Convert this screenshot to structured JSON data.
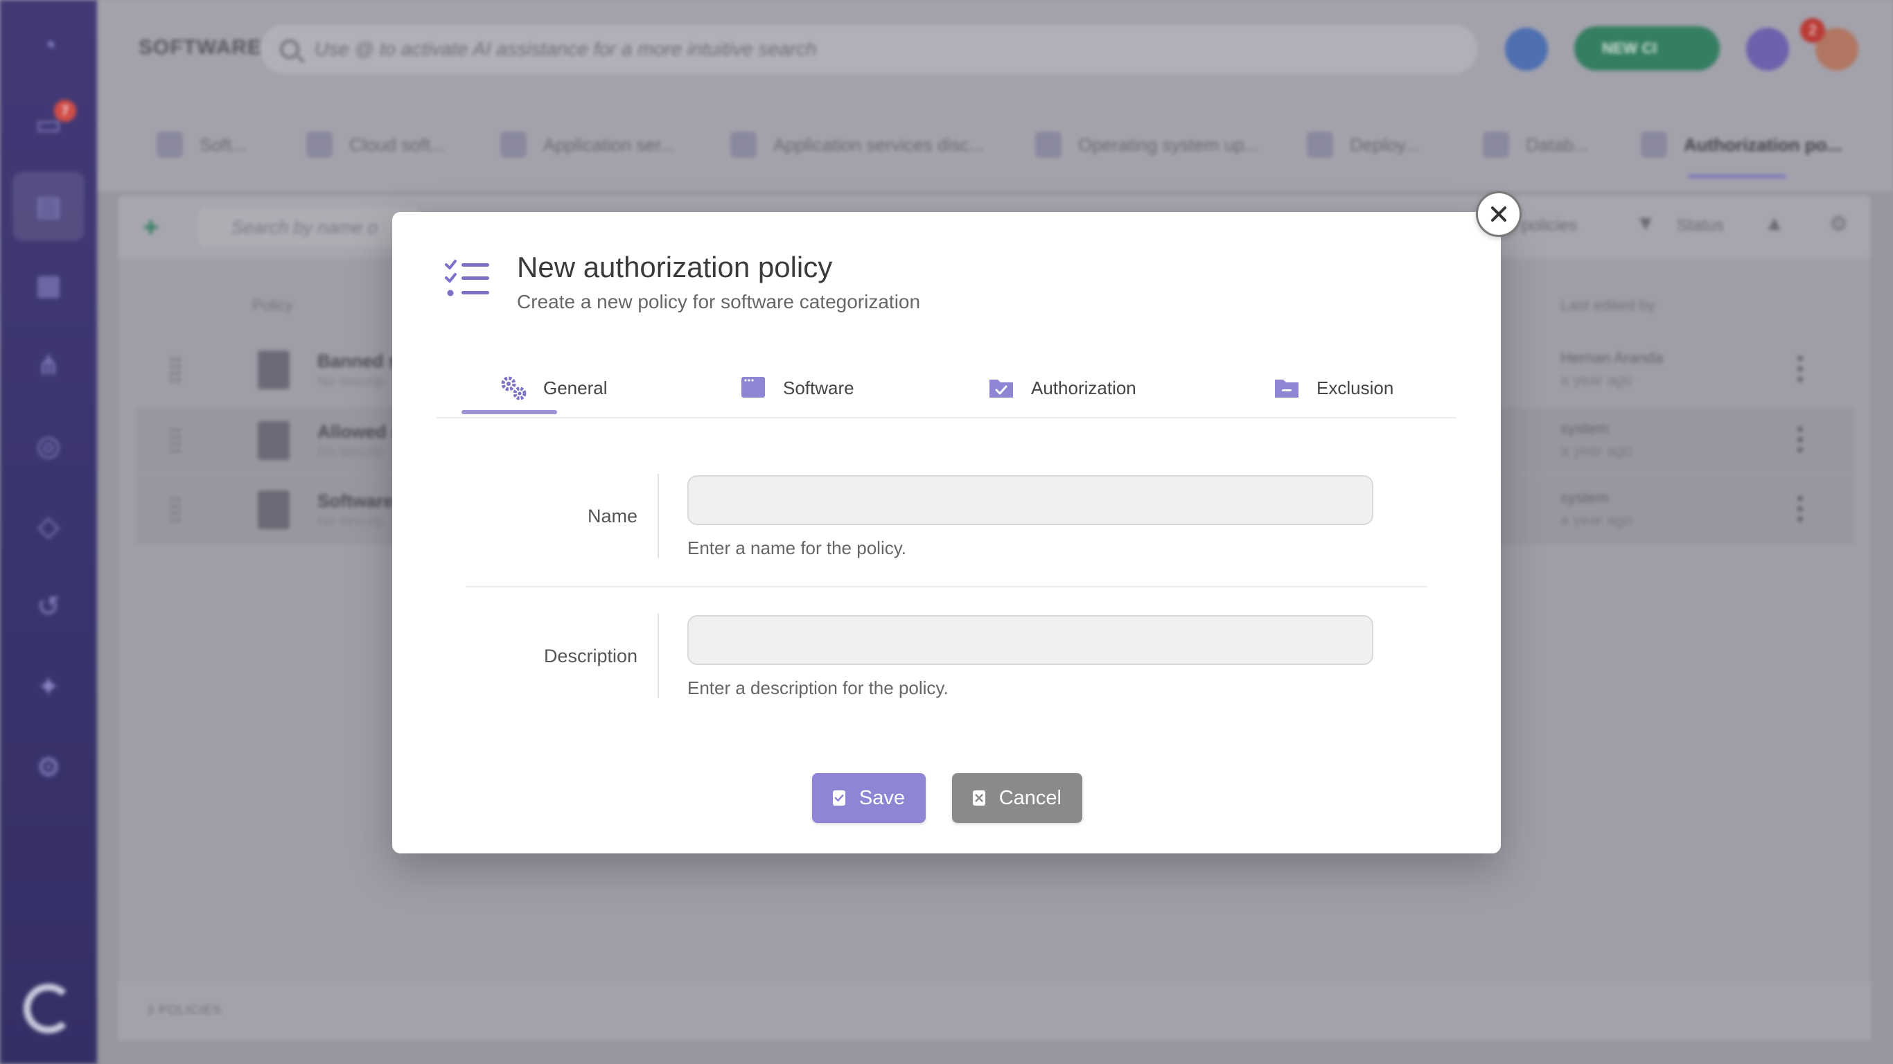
{
  "background": {
    "brand": "SOFTWARE",
    "search_placeholder": "Use @ to activate AI assistance for a more intuitive search",
    "new_button": "NEW CI",
    "top_badge": "2",
    "sidebar_badge": "7",
    "tabs": [
      {
        "label": "Soft..."
      },
      {
        "label": "Cloud soft..."
      },
      {
        "label": "Application ser..."
      },
      {
        "label": "Application services disc..."
      },
      {
        "label": "Operating system up..."
      },
      {
        "label": "Deploy..."
      },
      {
        "label": "Datab..."
      },
      {
        "label": "Authorization po..."
      }
    ],
    "table_search_placeholder": "Search by name o",
    "toolbar_policies": "e policies",
    "toolbar_status": "Status",
    "columns": {
      "policy": "Policy",
      "last_edited": "Last edited by"
    },
    "rows": [
      {
        "title": "Banned s",
        "subtitle": "No descrip",
        "user": "Hernan Aranda",
        "time": "a year ago"
      },
      {
        "title": "Allowed s",
        "subtitle": "No descrip",
        "user": "system",
        "time": "a year ago"
      },
      {
        "title": "Software",
        "subtitle": "No descrip",
        "user": "system",
        "time": "a year ago"
      }
    ],
    "footer": "3 POLICIES"
  },
  "modal": {
    "title": "New authorization policy",
    "subtitle": "Create a new policy for software categorization",
    "tabs": [
      {
        "label": "General",
        "icon": "gears-icon"
      },
      {
        "label": "Software",
        "icon": "window-icon"
      },
      {
        "label": "Authorization",
        "icon": "folder-check-icon"
      },
      {
        "label": "Exclusion",
        "icon": "folder-minus-icon"
      }
    ],
    "fields": {
      "name": {
        "label": "Name",
        "value": "",
        "help": "Enter a name for the policy."
      },
      "description": {
        "label": "Description",
        "value": "",
        "help": "Enter a description for the policy."
      }
    },
    "buttons": {
      "save": "Save",
      "cancel": "Cancel"
    }
  },
  "colors": {
    "accent": "#8e86d4",
    "cancel": "#8a8a8a",
    "sidebar": "#3e3575",
    "new_button": "#2f7f5f"
  }
}
